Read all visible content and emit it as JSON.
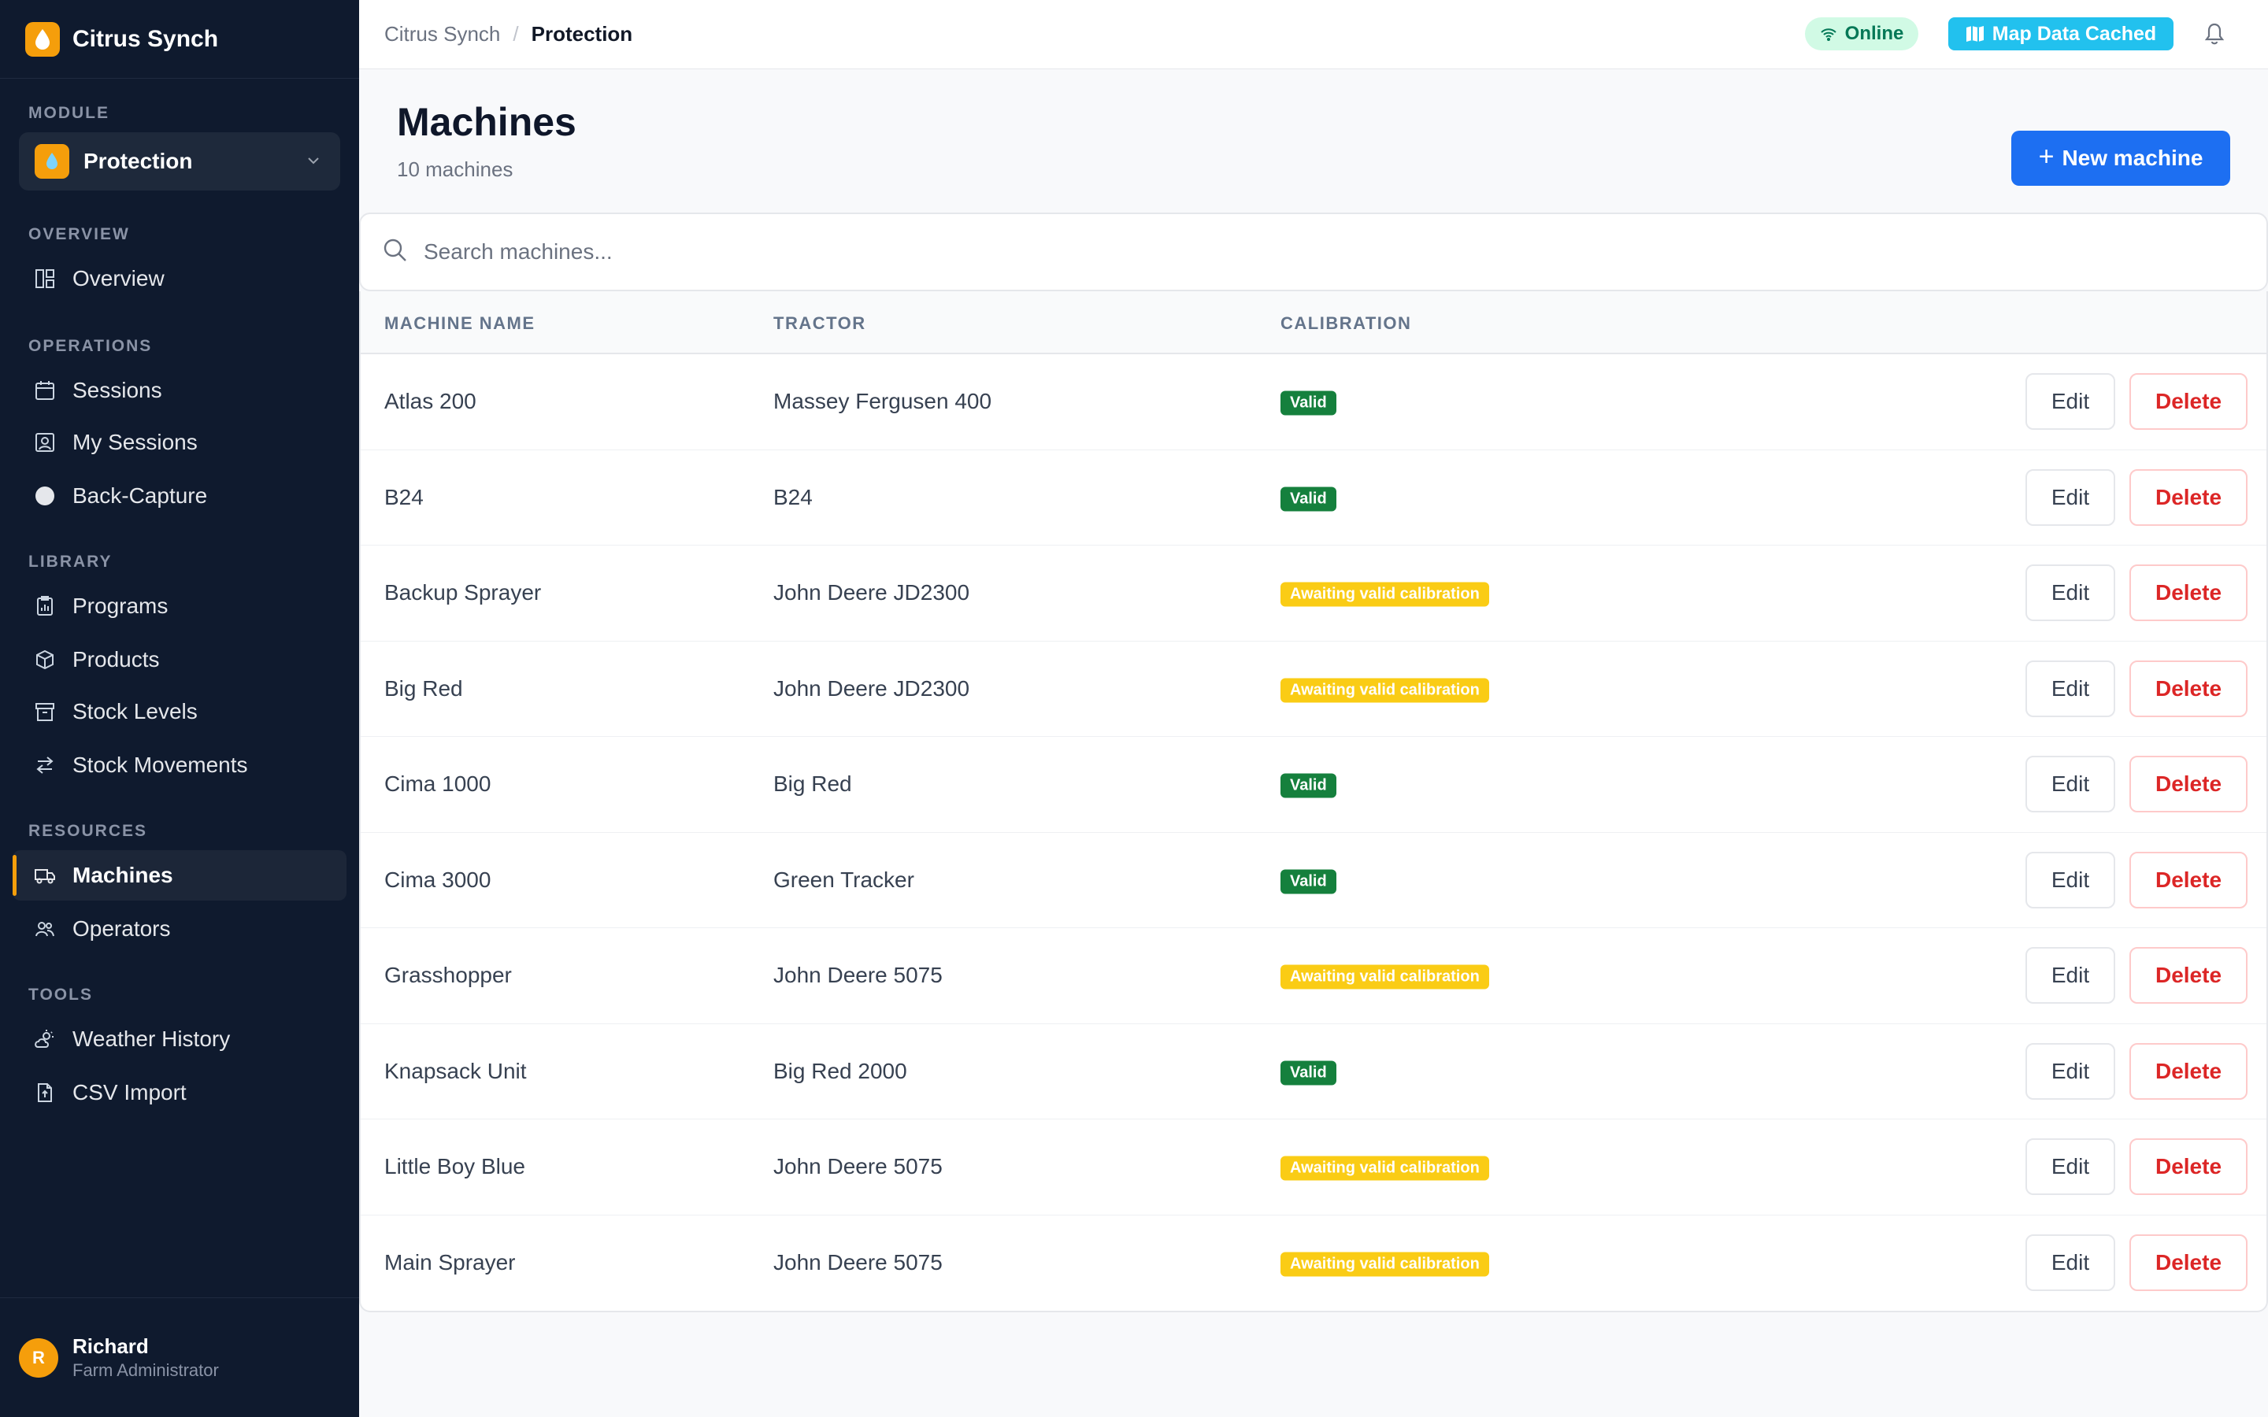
{
  "app": {
    "name": "Citrus Synch",
    "brand_color": "#f59e0b"
  },
  "sidebar": {
    "module_label": "MODULE",
    "module_name": "Protection",
    "sections": {
      "overview": "OVERVIEW",
      "operations": "OPERATIONS",
      "library": "LIBRARY",
      "resources": "RESOURCES",
      "tools": "TOOLS"
    },
    "items": {
      "overview": "Overview",
      "sessions": "Sessions",
      "my_sessions": "My Sessions",
      "back_capture": "Back-Capture",
      "programs": "Programs",
      "products": "Products",
      "stock_levels": "Stock Levels",
      "stock_movements": "Stock Movements",
      "machines": "Machines",
      "operators": "Operators",
      "weather_history": "Weather History",
      "csv_import": "CSV Import"
    },
    "active_item": "machines",
    "user": {
      "initial": "R",
      "name": "Richard",
      "role": "Farm Administrator"
    }
  },
  "topbar": {
    "breadcrumb": [
      "Citrus Synch",
      "Protection"
    ],
    "status_online": "Online",
    "status_map": "Map Data Cached",
    "online_color": "#047857",
    "map_color": "#22c1ee"
  },
  "page": {
    "title": "Machines",
    "subtitle": "10 machines",
    "new_button": "New machine",
    "search_placeholder": "Search machines..."
  },
  "table": {
    "headers": [
      "MACHINE NAME",
      "TRACTOR",
      "CALIBRATION"
    ],
    "edit_label": "Edit",
    "delete_label": "Delete",
    "rows": [
      {
        "name": "Atlas 200",
        "tractor": "Massey Fergusen 400",
        "calibration": "Valid"
      },
      {
        "name": "B24",
        "tractor": "B24",
        "calibration": "Valid"
      },
      {
        "name": "Backup Sprayer",
        "tractor": "John Deere JD2300",
        "calibration": "Awaiting valid calibration"
      },
      {
        "name": "Big Red",
        "tractor": "John Deere JD2300",
        "calibration": "Awaiting valid calibration"
      },
      {
        "name": "Cima 1000",
        "tractor": "Big Red",
        "calibration": "Valid"
      },
      {
        "name": "Cima 3000",
        "tractor": "Green Tracker",
        "calibration": "Valid"
      },
      {
        "name": "Grasshopper",
        "tractor": "John Deere 5075",
        "calibration": "Awaiting valid calibration"
      },
      {
        "name": "Knapsack Unit",
        "tractor": "Big Red 2000",
        "calibration": "Valid"
      },
      {
        "name": "Little Boy Blue",
        "tractor": "John Deere 5075",
        "calibration": "Awaiting valid calibration"
      },
      {
        "name": "Main Sprayer",
        "tractor": "John Deere 5075",
        "calibration": "Awaiting valid calibration"
      }
    ],
    "colors": {
      "valid": "#15803d",
      "awaiting": "#facc15",
      "delete": "#dc2626"
    }
  }
}
